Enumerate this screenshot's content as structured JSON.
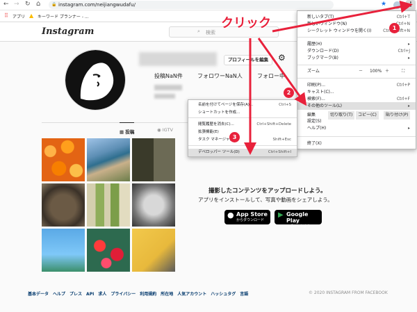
{
  "browser": {
    "url": "instagram.com/neijiangwudafu/",
    "apps": "アプリ",
    "bookmark": "キーワード プランナー - ..."
  },
  "ig": {
    "logo": "Instagram",
    "search_placeholder": "検索",
    "edit_profile": "プロフィールを編集",
    "posts": "投稿NaN件",
    "followers": "フォロワーNaN人",
    "following": "フォロー中",
    "tab_posts": "投稿",
    "tab_igtv": "IGTV",
    "upload_title": "撮影したコンテンツをアップロードしよう。",
    "upload_sub": "アプリをインストールして、写真や動画をシェアしよう。",
    "appstore_top": "App Store",
    "appstore_bottom": "からダウンロード",
    "gplay_top": "Google Play",
    "gplay_bottom": "で手に入れよう",
    "footer_links": [
      "基本データ",
      "ヘルプ",
      "プレス",
      "API",
      "求人",
      "プライバシー",
      "利用規約",
      "所在地",
      "人気アカウント",
      "ハッシュタグ",
      "言語"
    ],
    "copyright": "© 2020 INSTAGRAM FROM FACEBOOK"
  },
  "chrome_menu": {
    "items": [
      {
        "label": "新しいタブ(T)",
        "sc": "Ctrl+T"
      },
      {
        "label": "新しいウィンドウ(N)",
        "sc": "Ctrl+N"
      },
      {
        "label": "シークレット ウィンドウを開く(I)",
        "sc": "Ctrl+Shift+N"
      },
      {
        "label": "履歴(H)",
        "sc": "▸"
      },
      {
        "label": "ダウンロード(D)",
        "sc": "Ctrl+J"
      },
      {
        "label": "ブックマーク(B)",
        "sc": "▸"
      },
      {
        "label": "ズーム",
        "sc": ""
      },
      {
        "label": "印刷(P)...",
        "sc": "Ctrl+P"
      },
      {
        "label": "キャスト(C)...",
        "sc": ""
      },
      {
        "label": "検索(F)...",
        "sc": "Ctrl+F"
      },
      {
        "label": "その他のツール(L)",
        "sc": "▸"
      },
      {
        "label": "設定(S)",
        "sc": ""
      },
      {
        "label": "ヘルプ(H)",
        "sc": "▸"
      },
      {
        "label": "終了(X)",
        "sc": ""
      }
    ],
    "zoom_minus": "－",
    "zoom_value": "100%",
    "zoom_plus": "＋",
    "edit": "編集",
    "cut": "切り取り(T)",
    "copy": "コピー(C)",
    "paste": "貼り付け(P)"
  },
  "sub_menu": {
    "items": [
      {
        "label": "名前を付けてページを保存(A)...",
        "sc": "Ctrl+S"
      },
      {
        "label": "ショートカットを作成...",
        "sc": ""
      },
      {
        "label": "閲覧履歴を消去(C)...",
        "sc": "Ctrl+Shift+Delete"
      },
      {
        "label": "拡張機能(E)",
        "sc": ""
      },
      {
        "label": "タスク マネージャ(T)",
        "sc": "Shift+Esc"
      },
      {
        "label": "デベロッパー ツール(D)",
        "sc": "Ctrl+Shift+I"
      }
    ]
  },
  "annotation": {
    "click": "クリック",
    "b1": "1",
    "b2": "2",
    "b3": "3",
    "color": "#e8213b"
  }
}
